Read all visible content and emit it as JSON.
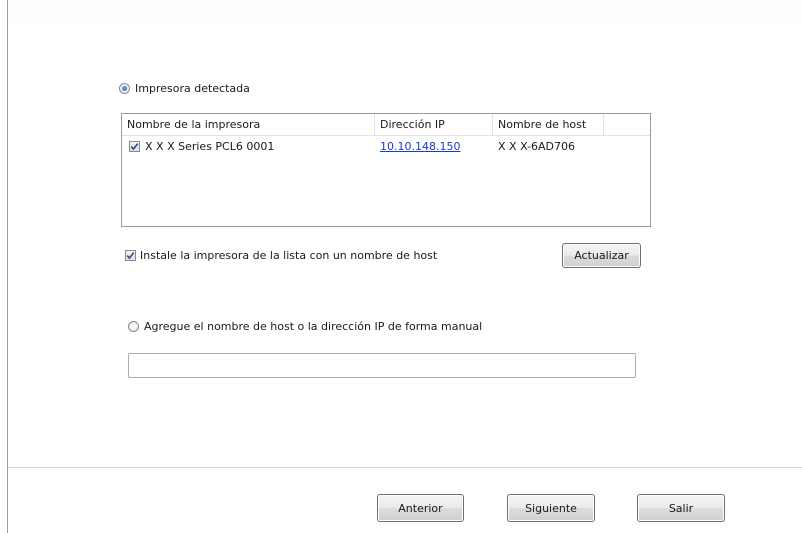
{
  "detected_option": {
    "label": "Impresora detectada",
    "selected": true
  },
  "printer_list": {
    "columns": [
      "Nombre de la impresora",
      "Dirección IP",
      "Nombre de host",
      ""
    ],
    "rows": [
      {
        "checked": true,
        "name": "X X X  Series PCL6 0001",
        "ip": "10.10.148.150",
        "host": "X X X-6AD706"
      }
    ]
  },
  "install_with_hostname": {
    "label": "Instale la impresora de la lista con un nombre de host",
    "checked": true
  },
  "refresh_button": {
    "label": "Actualizar"
  },
  "manual_option": {
    "label": "Agregue el nombre de host o la dirección IP de forma manual",
    "selected": false
  },
  "manual_input": {
    "value": "",
    "placeholder": ""
  },
  "footer": {
    "back_label": "Anterior",
    "next_label": "Siguiente",
    "exit_label": "Salir"
  },
  "colors": {
    "link": "#1a3ccc",
    "radio_selected": "#1f5fb2",
    "check_mark": "#2a4a8a"
  }
}
